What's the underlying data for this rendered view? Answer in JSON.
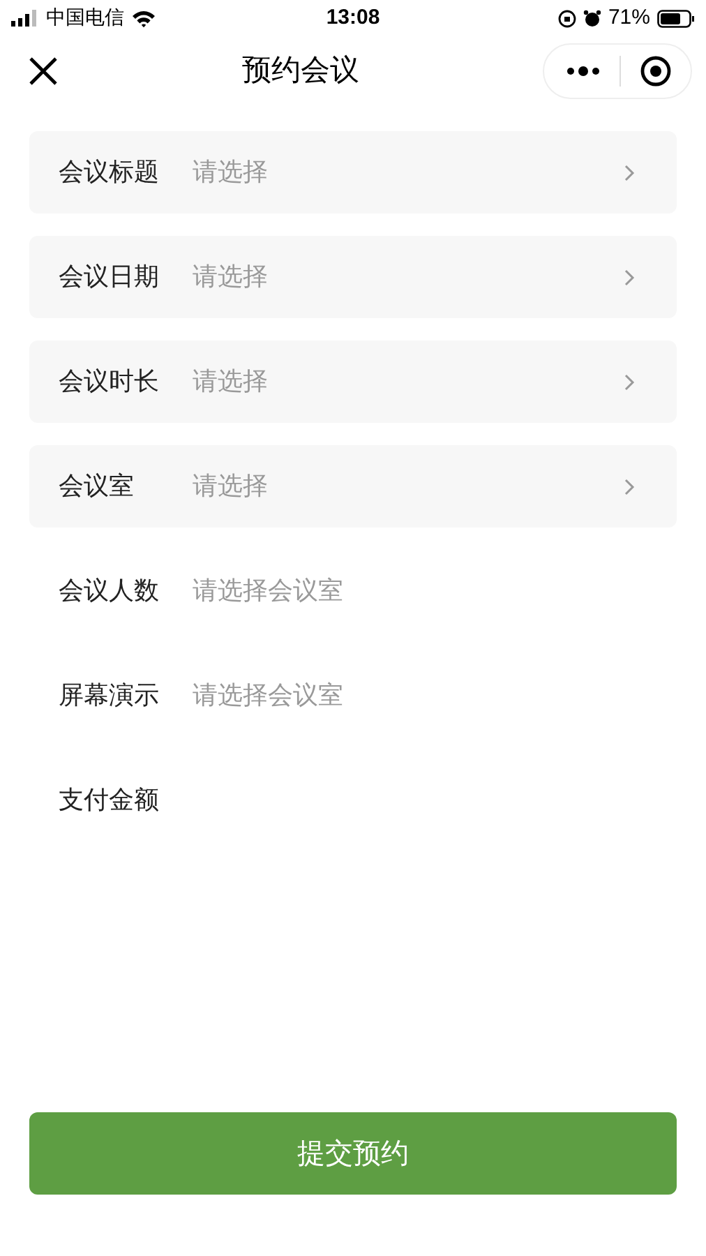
{
  "status_bar": {
    "carrier": "中国电信",
    "time": "13:08",
    "battery": "71%"
  },
  "header": {
    "title": "预约会议"
  },
  "form": {
    "rows": [
      {
        "kind": "select",
        "label": "会议标题",
        "placeholder": "请选择"
      },
      {
        "kind": "select",
        "label": "会议日期",
        "placeholder": "请选择"
      },
      {
        "kind": "select",
        "label": "会议时长",
        "placeholder": "请选择"
      },
      {
        "kind": "select",
        "label": "会议室",
        "placeholder": "请选择"
      },
      {
        "kind": "info",
        "label": "会议人数",
        "value": "请选择会议室"
      },
      {
        "kind": "info",
        "label": "屏幕演示",
        "value": "请选择会议室"
      },
      {
        "kind": "info",
        "label": "支付金额"
      }
    ]
  },
  "submit_button": {
    "label": "提交预约"
  }
}
